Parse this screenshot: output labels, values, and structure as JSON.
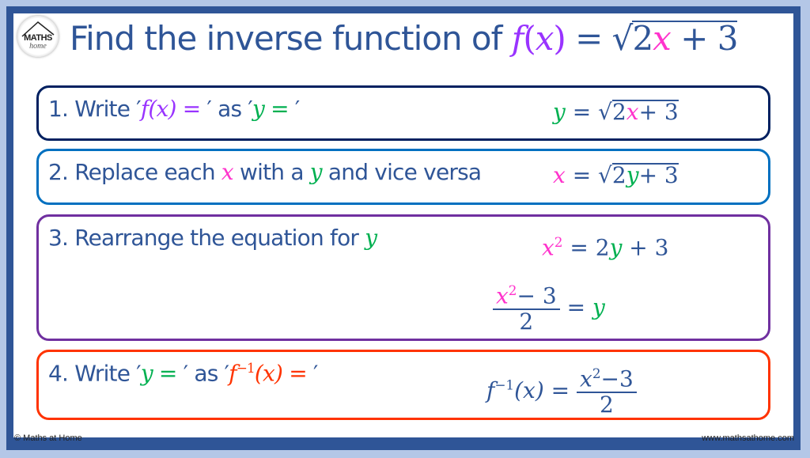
{
  "brand": {
    "logo_top": "MATHS",
    "logo_bottom": "home"
  },
  "title": {
    "text": "Find the inverse function of ",
    "func": "f",
    "lparen": "(",
    "var": "x",
    "rparen": ")",
    "eq": " = √",
    "rad_a": "2",
    "rad_x": "x",
    "rad_b": " + 3"
  },
  "steps": [
    {
      "number": "1.",
      "label_a": " Write ′",
      "label_f": "f(x) = ",
      "label_b": "′ as ′",
      "label_y": "y = ",
      "label_c": "′",
      "eq_lhs": "y",
      "eq_mid": " = √",
      "eq_r1": "2",
      "eq_rx": "x",
      "eq_r2": "+ 3"
    },
    {
      "number": "2.",
      "label_a": " Replace each ",
      "label_x": "x",
      "label_b": " with a ",
      "label_y": "y",
      "label_c": " and vice versa",
      "eq_lhs": "x",
      "eq_mid": " = √",
      "eq_r1": "2",
      "eq_ry": "y",
      "eq_r2": "+ 3"
    },
    {
      "number": "3.",
      "label_a": " Rearrange the equation for ",
      "label_y": "y",
      "eq1_lhs": "x",
      "eq1_exp": "2",
      "eq1_mid": " = 2",
      "eq1_y": "y",
      "eq1_rest": " + 3",
      "eq2_num_x": "x",
      "eq2_num_exp": "2",
      "eq2_num_rest": "− 3",
      "eq2_den": "2",
      "eq2_mid": " = ",
      "eq2_y": "y"
    },
    {
      "number": "4.",
      "label_a": " Write ′",
      "label_y": "y = ",
      "label_b": "′ as ′",
      "label_f": "f",
      "label_exp": "−1",
      "label_fx": "(x) = ",
      "label_c": "′",
      "eq_f": "f",
      "eq_exp": "−1",
      "eq_fx": "(x) = ",
      "eq_num_x": "x",
      "eq_num_exp": "2",
      "eq_num_rest": "−3",
      "eq_den": "2"
    }
  ],
  "footer": {
    "copyright": "© Maths at Home",
    "website": "www.mathsathome.com"
  },
  "colors": {
    "frame": "#2f5597",
    "text": "#2f5597",
    "f_purple": "#9933ff",
    "x_pink": "#ff33cc",
    "y_green": "#00b050",
    "inverse_red": "#ff3300",
    "box1": "#002060",
    "box2": "#0070c0",
    "box3": "#7030a0",
    "box4": "#ff3300"
  }
}
